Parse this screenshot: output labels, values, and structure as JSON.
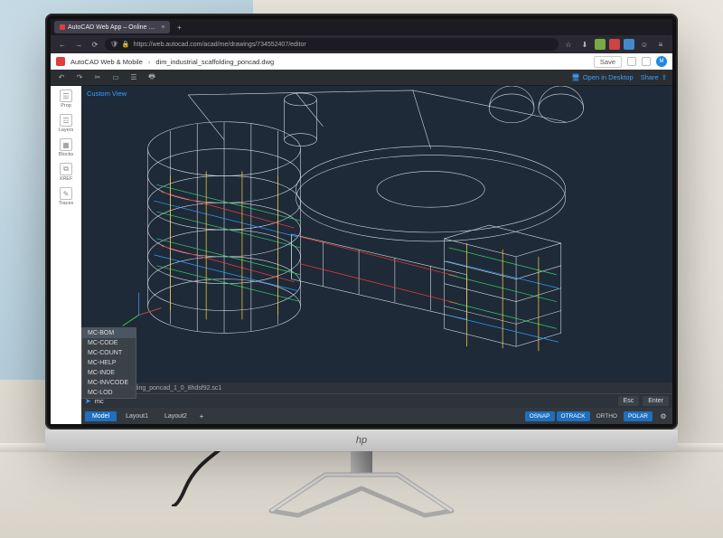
{
  "browser": {
    "tab_title": "AutoCAD Web App – Online …",
    "url": "https://web.autocad.com/acad/me/drawings/734552407/editor"
  },
  "header": {
    "product": "AutoCAD Web & Mobile",
    "filename": "dim_industrial_scaffolding_poncad.dwg",
    "save_label": "Save",
    "avatar_initials": "M"
  },
  "toolbar": {
    "open_desktop": "Open in Desktop",
    "share": "Share"
  },
  "sidebar": {
    "items": [
      {
        "label": "Prop"
      },
      {
        "label": "Layers"
      },
      {
        "label": "Blocks"
      },
      {
        "label": "XREF"
      },
      {
        "label": "Traces"
      }
    ]
  },
  "view": {
    "label": "Custom View"
  },
  "autocomplete": {
    "items": [
      "MC-BOM",
      "MC-CODE",
      "MC-COUNT",
      "MC-HELP",
      "MC-INDE",
      "MC-INVCODE",
      "MC-LOD"
    ],
    "selected": 0
  },
  "cmd": {
    "recent_file": "industrial_scaffolding_poncad_1_0_8hdsf92.sc1",
    "prompt": "mc",
    "esc": "Esc",
    "enter": "Enter"
  },
  "layout_tabs": {
    "items": [
      "Model",
      "Layout1",
      "Layout2"
    ],
    "active": 0
  },
  "status": {
    "toggles": [
      {
        "label": "OSNAP",
        "on": true
      },
      {
        "label": "OTRACK",
        "on": true
      },
      {
        "label": "ORTHO",
        "on": false
      },
      {
        "label": "POLAR",
        "on": true
      }
    ]
  },
  "monitor_brand": "hp"
}
